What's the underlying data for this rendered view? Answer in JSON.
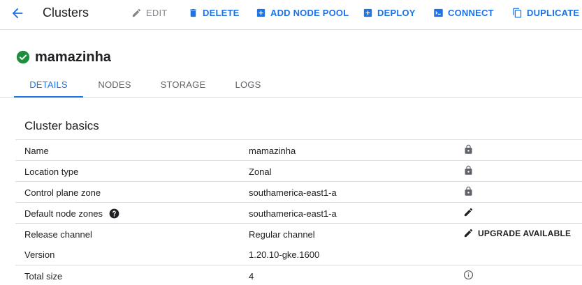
{
  "toolbar": {
    "title": "Clusters",
    "buttons": {
      "edit": "EDIT",
      "delete": "DELETE",
      "add_node_pool": "ADD NODE POOL",
      "deploy": "DEPLOY",
      "connect": "CONNECT",
      "duplicate": "DUPLICATE"
    }
  },
  "cluster": {
    "name": "mamazinha",
    "status_icon": "check-circle-icon",
    "status_color": "#1e8e3e"
  },
  "tabs": [
    "DETAILS",
    "NODES",
    "STORAGE",
    "LOGS"
  ],
  "active_tab": "DETAILS",
  "section": {
    "title": "Cluster basics",
    "rows": [
      {
        "label": "Name",
        "value": "mamazinha",
        "action_icon": "lock-icon"
      },
      {
        "label": "Location type",
        "value": "Zonal",
        "action_icon": "lock-icon"
      },
      {
        "label": "Control plane zone",
        "value": "southamerica-east1-a",
        "action_icon": "lock-icon"
      },
      {
        "label": "Default node zones",
        "value": "southamerica-east1-a",
        "action_icon": "edit-pencil-icon",
        "help_icon": "help-icon"
      },
      {
        "label": "Release channel",
        "value": "Regular channel",
        "action_icon": "edit-pencil-icon",
        "action_label": "UPGRADE AVAILABLE"
      },
      {
        "label": "Version",
        "value": "1.20.10-gke.1600"
      },
      {
        "label": "Total size",
        "value": "4",
        "action_icon": "info-icon"
      }
    ]
  },
  "colors": {
    "accent": "#1a73e8",
    "text": "#202124",
    "muted": "#5f6368",
    "divider": "#dadce0"
  }
}
